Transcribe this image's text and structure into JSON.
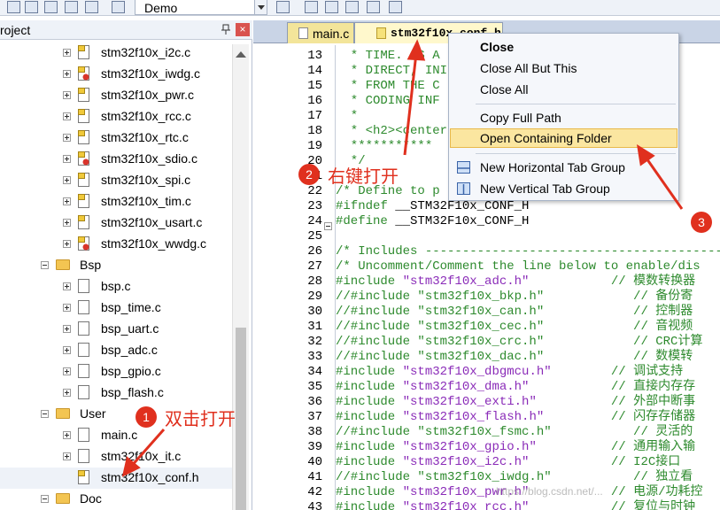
{
  "toolbar": {
    "target_name": "Demo"
  },
  "project_panel": {
    "title": "roject",
    "pin_glyph": "↑",
    "close_glyph": "×"
  },
  "tree": {
    "items": [
      {
        "label": "stm32f10x_i2c.c",
        "type": "c-file"
      },
      {
        "label": "stm32f10x_iwdg.c",
        "type": "c-file-err"
      },
      {
        "label": "stm32f10x_pwr.c",
        "type": "c-file"
      },
      {
        "label": "stm32f10x_rcc.c",
        "type": "c-file"
      },
      {
        "label": "stm32f10x_rtc.c",
        "type": "c-file"
      },
      {
        "label": "stm32f10x_sdio.c",
        "type": "c-file-err"
      },
      {
        "label": "stm32f10x_spi.c",
        "type": "c-file"
      },
      {
        "label": "stm32f10x_tim.c",
        "type": "c-file"
      },
      {
        "label": "stm32f10x_usart.c",
        "type": "c-file"
      },
      {
        "label": "stm32f10x_wwdg.c",
        "type": "c-file-err"
      },
      {
        "label": "Bsp",
        "type": "folder"
      },
      {
        "label": "bsp.c",
        "type": "file"
      },
      {
        "label": "bsp_time.c",
        "type": "file"
      },
      {
        "label": "bsp_uart.c",
        "type": "file"
      },
      {
        "label": "bsp_adc.c",
        "type": "file"
      },
      {
        "label": "bsp_gpio.c",
        "type": "file"
      },
      {
        "label": "bsp_flash.c",
        "type": "file"
      },
      {
        "label": "User",
        "type": "folder"
      },
      {
        "label": "main.c",
        "type": "file"
      },
      {
        "label": "stm32f10x_it.c",
        "type": "file"
      },
      {
        "label": "stm32f10x_conf.h",
        "type": "h-file"
      },
      {
        "label": "Doc",
        "type": "folder"
      }
    ]
  },
  "editor": {
    "tabs": [
      {
        "label": "main.c"
      },
      {
        "label": "stm32f10x_conf.h"
      }
    ],
    "lines": [
      {
        "n": "13",
        "segs": [
          {
            "c": "c-cmt",
            "t": "  * TIME. AS A"
          },
          {
            "c": "c-cmt",
            "t": "                    HALL N"
          }
        ]
      },
      {
        "n": "14",
        "segs": [
          {
            "c": "c-cmt",
            "t": "  * DIRECT, INI"
          },
          {
            "c": "c-cmt",
            "t": "                   ES WIT"
          }
        ]
      },
      {
        "n": "15",
        "segs": [
          {
            "c": "c-cmt",
            "t": "  * FROM THE C"
          },
          {
            "c": "c-cmt",
            "t": "                    R THE "
          }
        ]
      },
      {
        "n": "16",
        "segs": [
          {
            "c": "c-cmt",
            "t": "  * CODING INF"
          },
          {
            "c": "c-cmt",
            "t": "                    CONNEC"
          }
        ]
      },
      {
        "n": "17",
        "segs": [
          {
            "c": "c-cmt",
            "t": "  *"
          }
        ]
      },
      {
        "n": "18",
        "segs": [
          {
            "c": "c-cmt",
            "t": "  * <h2><center"
          },
          {
            "c": "c-cmt",
            "t": "                    roelec"
          }
        ]
      },
      {
        "n": "19",
        "segs": [
          {
            "c": "c-cmt",
            "t": "  ***********"
          },
          {
            "c": "c-cmt",
            "t": "                   ******"
          }
        ]
      },
      {
        "n": "20",
        "segs": [
          {
            "c": "c-cmt",
            "t": "  */"
          }
        ]
      },
      {
        "n": "21",
        "segs": [
          {
            "c": "c-blk",
            "t": ""
          }
        ]
      },
      {
        "n": "22",
        "segs": [
          {
            "c": "c-cmt",
            "t": "/* Define to p"
          },
          {
            "c": "c-cmt",
            "t": "                   ---------"
          }
        ]
      },
      {
        "n": "23",
        "segs": [
          {
            "c": "c-pre",
            "t": "#ifndef"
          },
          {
            "c": "c-blk",
            "t": " __STM32F10x_CONF_H"
          }
        ]
      },
      {
        "n": "24",
        "segs": [
          {
            "c": "c-pre",
            "t": "#define"
          },
          {
            "c": "c-blk",
            "t": " __STM32F10x_CONF_H"
          }
        ]
      },
      {
        "n": "25",
        "segs": [
          {
            "c": "c-blk",
            "t": ""
          }
        ]
      },
      {
        "n": "26",
        "segs": [
          {
            "c": "c-cmt",
            "t": "/* Includes ------------------------------------------"
          }
        ]
      },
      {
        "n": "27",
        "segs": [
          {
            "c": "c-cmt",
            "t": "/* Uncomment/Comment the line below to enable/dis"
          }
        ]
      },
      {
        "n": "28",
        "segs": [
          {
            "c": "c-pre",
            "t": "#include "
          },
          {
            "c": "c-str",
            "t": "\"stm32f10x_adc.h\""
          },
          {
            "c": "c-cn",
            "t": "           // 模数转换器"
          }
        ]
      },
      {
        "n": "29",
        "segs": [
          {
            "c": "c-cmt",
            "t": "//#include \"stm32f10x_bkp.h\"            // 备份寄"
          }
        ]
      },
      {
        "n": "30",
        "segs": [
          {
            "c": "c-cmt",
            "t": "//#include \"stm32f10x_can.h\"            // 控制器"
          }
        ]
      },
      {
        "n": "31",
        "segs": [
          {
            "c": "c-cmt",
            "t": "//#include \"stm32f10x_cec.h\"            // 音视频"
          }
        ]
      },
      {
        "n": "32",
        "segs": [
          {
            "c": "c-cmt",
            "t": "//#include \"stm32f10x_crc.h\"            // CRC计算"
          }
        ]
      },
      {
        "n": "33",
        "segs": [
          {
            "c": "c-cmt",
            "t": "//#include \"stm32f10x_dac.h\"            // 数模转"
          }
        ]
      },
      {
        "n": "34",
        "segs": [
          {
            "c": "c-pre",
            "t": "#include "
          },
          {
            "c": "c-str",
            "t": "\"stm32f10x_dbgmcu.h\""
          },
          {
            "c": "c-cn",
            "t": "        // 调试支持"
          }
        ]
      },
      {
        "n": "35",
        "segs": [
          {
            "c": "c-pre",
            "t": "#include "
          },
          {
            "c": "c-str",
            "t": "\"stm32f10x_dma.h\""
          },
          {
            "c": "c-cn",
            "t": "           // 直接内存存"
          }
        ]
      },
      {
        "n": "36",
        "segs": [
          {
            "c": "c-pre",
            "t": "#include "
          },
          {
            "c": "c-str",
            "t": "\"stm32f10x_exti.h\""
          },
          {
            "c": "c-cn",
            "t": "          // 外部中断事"
          }
        ]
      },
      {
        "n": "37",
        "segs": [
          {
            "c": "c-pre",
            "t": "#include "
          },
          {
            "c": "c-str",
            "t": "\"stm32f10x_flash.h\""
          },
          {
            "c": "c-cn",
            "t": "         // 闪存存储器"
          }
        ]
      },
      {
        "n": "38",
        "segs": [
          {
            "c": "c-cmt",
            "t": "//#include \"stm32f10x_fsmc.h\"           // 灵活的"
          }
        ]
      },
      {
        "n": "39",
        "segs": [
          {
            "c": "c-pre",
            "t": "#include "
          },
          {
            "c": "c-str",
            "t": "\"stm32f10x_gpio.h\""
          },
          {
            "c": "c-cn",
            "t": "          // 通用输入输"
          }
        ]
      },
      {
        "n": "40",
        "segs": [
          {
            "c": "c-pre",
            "t": "#include "
          },
          {
            "c": "c-str",
            "t": "\"stm32f10x_i2c.h\""
          },
          {
            "c": "c-cn",
            "t": "           // I2C接口"
          }
        ]
      },
      {
        "n": "41",
        "segs": [
          {
            "c": "c-cmt",
            "t": "//#include \"stm32f10x_iwdg.h\"           // 独立看"
          }
        ]
      },
      {
        "n": "42",
        "segs": [
          {
            "c": "c-pre",
            "t": "#include "
          },
          {
            "c": "c-str",
            "t": "\"stm32f10x_pwr.h\""
          },
          {
            "c": "c-cn",
            "t": "           // 电源/功耗控"
          }
        ]
      },
      {
        "n": "43",
        "segs": [
          {
            "c": "c-pre",
            "t": "#include "
          },
          {
            "c": "c-str",
            "t": "\"stm32f10x_rcc.h\""
          },
          {
            "c": "c-cn",
            "t": "           // 复位与时钟"
          }
        ]
      }
    ]
  },
  "context_menu": {
    "items": [
      {
        "label": "Close",
        "bold": true
      },
      {
        "label": "Close All But This"
      },
      {
        "label": "Close All"
      },
      {
        "label": "Copy Full Path"
      },
      {
        "label": "Open Containing Folder",
        "highlighted": true
      },
      {
        "label": "New Horizontal Tab Group",
        "icon": "horizontal-tab-group-icon"
      },
      {
        "label": "New Vertical Tab Group",
        "icon": "vertical-tab-group-icon"
      }
    ]
  },
  "annotations": {
    "step1_num": "1",
    "step1_text": "双击打开",
    "step2_num": "2",
    "step2_text": "右键打开",
    "step3_num": "3",
    "color": "#e0301e"
  },
  "watermark": "https://blog.csdn.net/..."
}
